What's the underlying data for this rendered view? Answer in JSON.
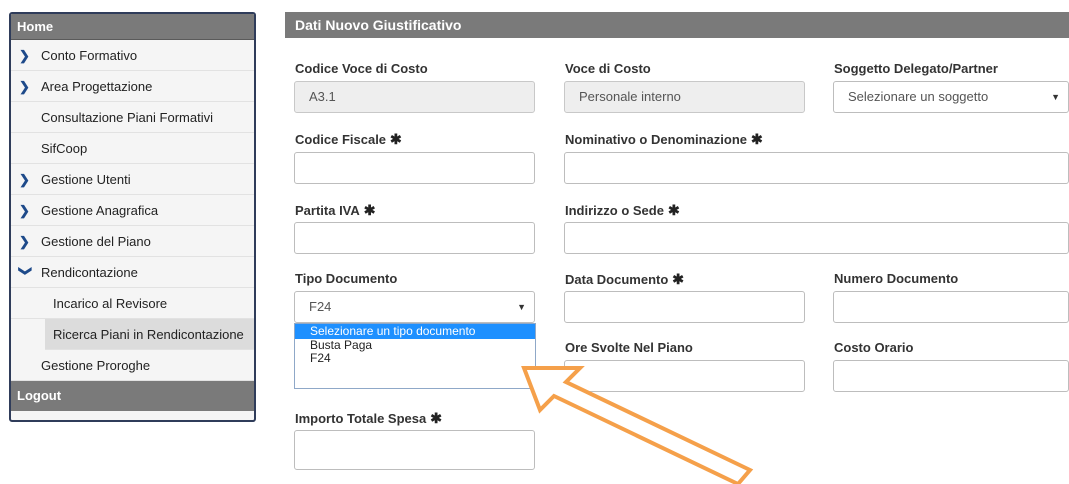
{
  "sidebar": {
    "home": "Home",
    "items": [
      {
        "label": "Conto Formativo"
      },
      {
        "label": "Area Progettazione"
      },
      {
        "label": "Consultazione Piani Formativi"
      },
      {
        "label": "SifCoop"
      },
      {
        "label": "Gestione Utenti"
      },
      {
        "label": "Gestione Anagrafica"
      },
      {
        "label": "Gestione del Piano"
      },
      {
        "label": "Rendicontazione"
      },
      {
        "label": "Incarico al Revisore"
      },
      {
        "label": "Ricerca Piani in Rendicontazione"
      },
      {
        "label": "Gestione Proroghe"
      }
    ],
    "logout": "Logout"
  },
  "panel": {
    "title": "Dati Nuovo Giustificativo",
    "codice_voce": {
      "label": "Codice Voce di Costo",
      "value": "A3.1"
    },
    "voce": {
      "label": "Voce di Costo",
      "value": "Personale interno"
    },
    "soggetto": {
      "label": "Soggetto Delegato/Partner",
      "value": "Selezionare un soggetto"
    },
    "codice_fiscale": {
      "label": "Codice Fiscale",
      "value": ""
    },
    "nominativo": {
      "label": "Nominativo o Denominazione",
      "value": ""
    },
    "partita_iva": {
      "label": "Partita IVA",
      "value": ""
    },
    "indirizzo": {
      "label": "Indirizzo o Sede",
      "value": ""
    },
    "tipo_documento": {
      "label": "Tipo Documento",
      "value": "F24",
      "options": [
        "Selezionare un tipo documento",
        "Busta Paga",
        "F24"
      ]
    },
    "data_documento": {
      "label": "Data Documento",
      "value": ""
    },
    "numero_documento": {
      "label": "Numero Documento",
      "value": ""
    },
    "ore_svolte": {
      "label": "Ore Svolte Nel Piano",
      "value": ""
    },
    "costo_orario": {
      "label": "Costo Orario",
      "value": ""
    },
    "importo_totale": {
      "label": "Importo Totale Spesa",
      "value": ""
    },
    "required_mark": "✱"
  },
  "colors": {
    "header_gray": "#7a7a7a",
    "sidebar_border": "#2f3c5a",
    "chevron_blue": "#1e4a8a",
    "dropdown_highlight": "#1e90ff",
    "arrow_orange": "#f5a04a"
  }
}
